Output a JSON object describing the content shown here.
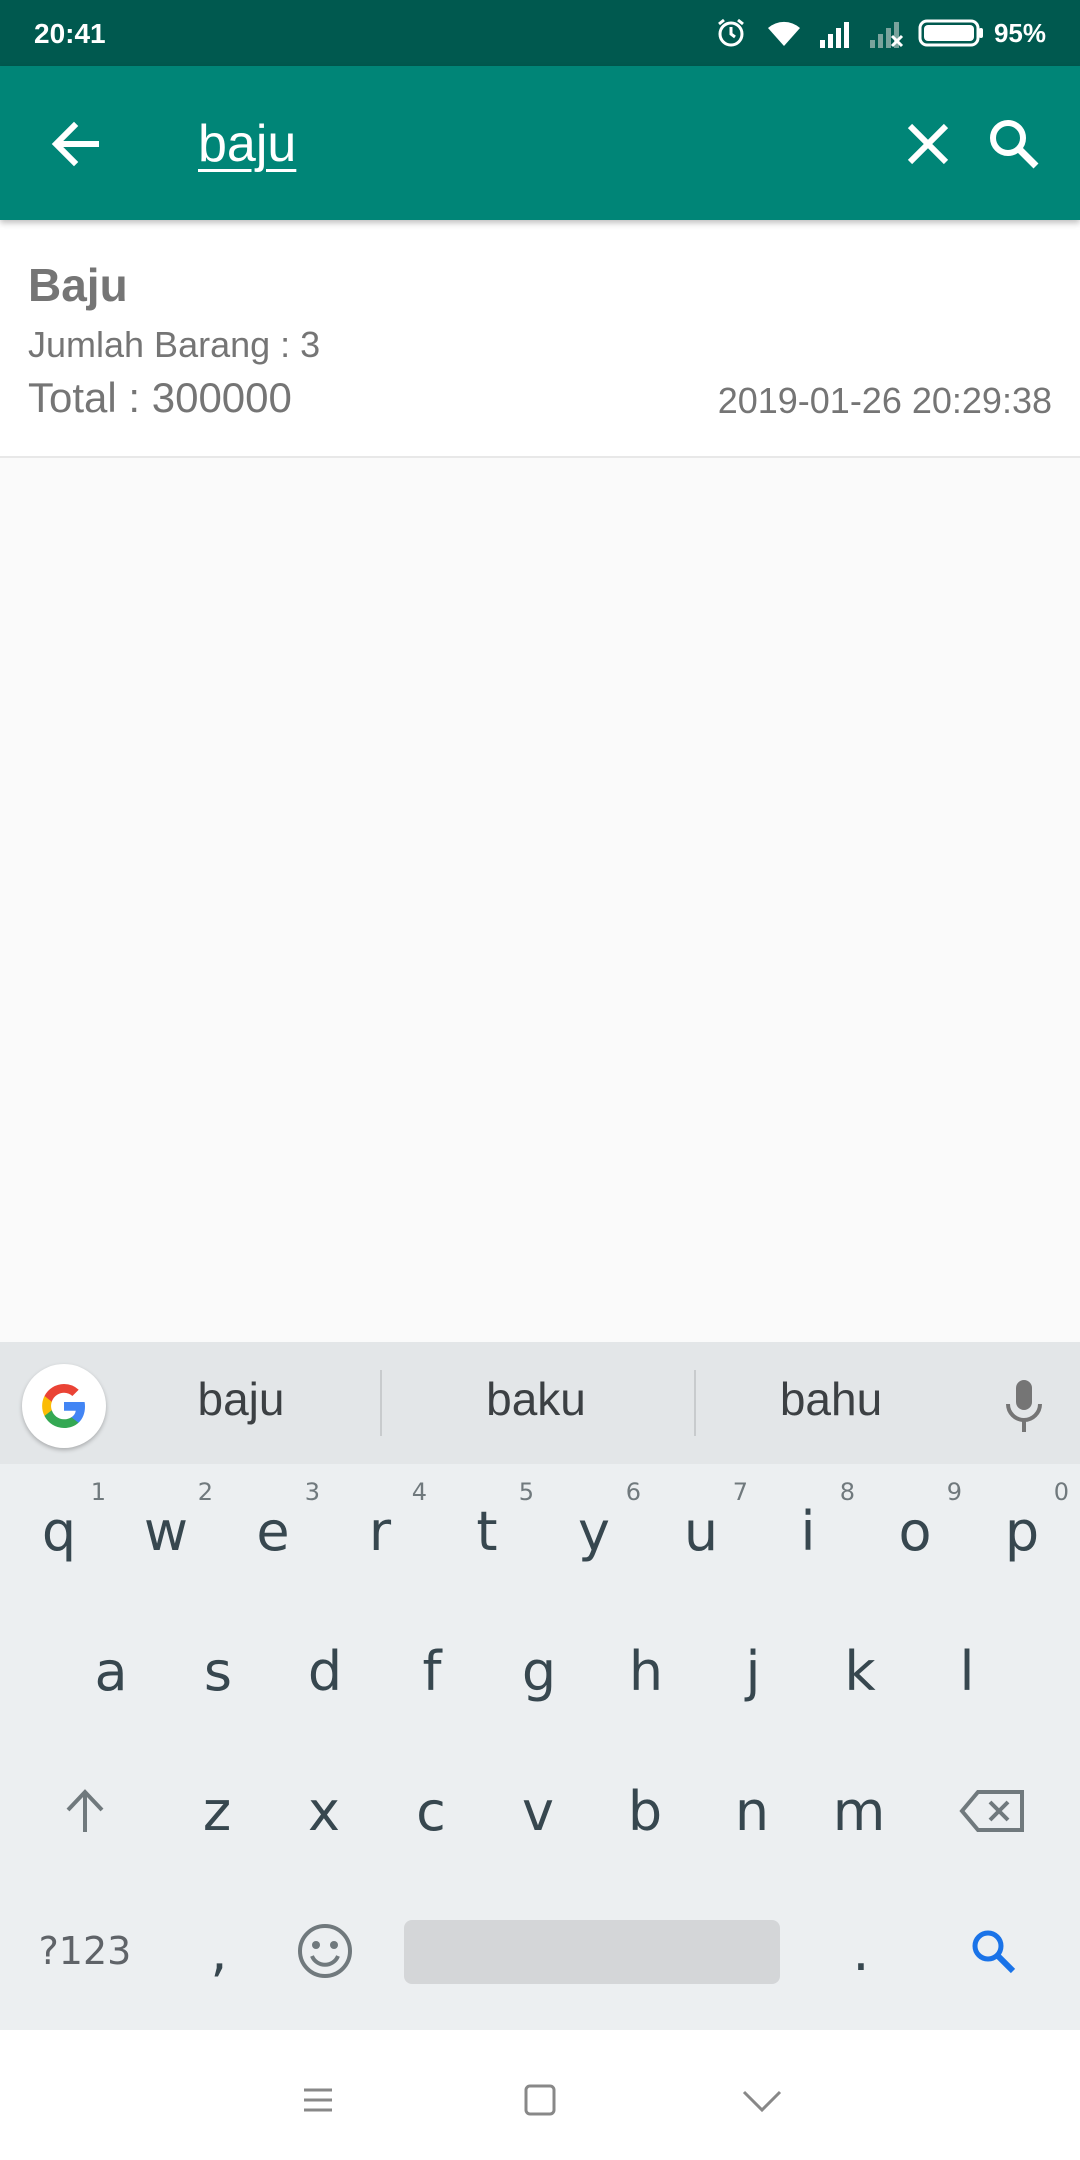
{
  "status_bar": {
    "time": "20:41",
    "battery": "95%",
    "icons": [
      "alarm-icon",
      "wifi-icon",
      "signal-icon",
      "signal-no-sim-icon",
      "battery-icon"
    ]
  },
  "toolbar": {
    "search_query": "baju",
    "icons": [
      "back-arrow-icon",
      "close-icon",
      "search-icon"
    ],
    "color": "#008577"
  },
  "result": {
    "title": "Baju",
    "quantity": "Jumlah Barang : 3",
    "total": "Total : 300000",
    "date": "2019-01-26 20:29:38"
  },
  "keyboard": {
    "suggestions": [
      "baju",
      "baku",
      "bahu"
    ],
    "row1": [
      {
        "k": "q",
        "h": "1"
      },
      {
        "k": "w",
        "h": "2"
      },
      {
        "k": "e",
        "h": "3"
      },
      {
        "k": "r",
        "h": "4"
      },
      {
        "k": "t",
        "h": "5"
      },
      {
        "k": "y",
        "h": "6"
      },
      {
        "k": "u",
        "h": "7"
      },
      {
        "k": "i",
        "h": "8"
      },
      {
        "k": "o",
        "h": "9"
      },
      {
        "k": "p",
        "h": "0"
      }
    ],
    "row2": [
      "a",
      "s",
      "d",
      "f",
      "g",
      "h",
      "j",
      "k",
      "l"
    ],
    "row3": [
      "z",
      "x",
      "c",
      "v",
      "b",
      "n",
      "m"
    ],
    "symbols_label": "?123",
    "comma": ",",
    "period": ".",
    "accent": "#1a73e8"
  },
  "nav_bar": {
    "icons": [
      "menu-icon",
      "home-square-icon",
      "back-chevron-icon"
    ]
  }
}
